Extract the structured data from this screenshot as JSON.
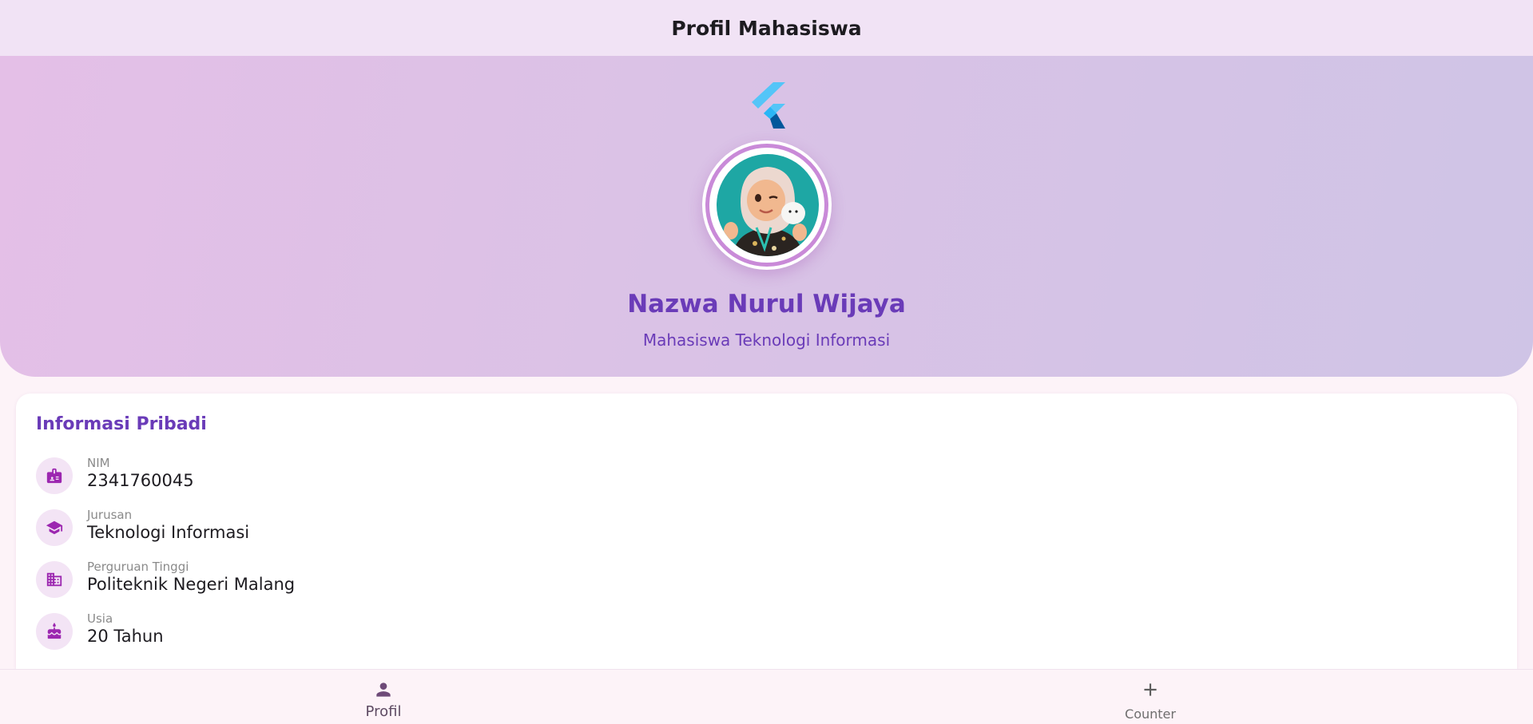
{
  "app_bar": {
    "title": "Profil Mahasiswa"
  },
  "profile": {
    "name": "Nazwa Nurul Wijaya",
    "subtitle": "Mahasiswa Teknologi Informasi"
  },
  "info_card": {
    "title": "Informasi Pribadi",
    "items": [
      {
        "label": "NIM",
        "value": "2341760045",
        "icon": "badge-icon"
      },
      {
        "label": "Jurusan",
        "value": "Teknologi Informasi",
        "icon": "school-icon"
      },
      {
        "label": "Perguruan Tinggi",
        "value": "Politeknik Negeri Malang",
        "icon": "business-icon"
      },
      {
        "label": "Usia",
        "value": "20 Tahun",
        "icon": "cake-icon"
      }
    ]
  },
  "bottom_nav": {
    "items": [
      {
        "label": "Profil",
        "icon": "person-icon",
        "selected": true
      },
      {
        "label": "Counter",
        "icon": "add-icon",
        "selected": false
      }
    ]
  },
  "colors": {
    "accent": "#6a3bb8",
    "icon_purple": "#9c27b0",
    "app_bar_bg": "#f1e3f5",
    "icon_circle_bg": "#f3e4f5"
  }
}
